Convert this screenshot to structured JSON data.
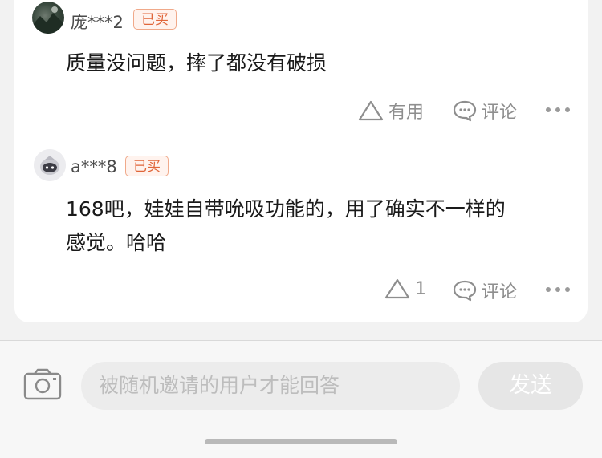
{
  "reviews": [
    {
      "username": "庞***2",
      "badge": "已买",
      "content": "质量没问题，摔了都没有破损",
      "like_label": "有用",
      "comment_label": "评论"
    },
    {
      "username": "a***8",
      "badge": "已买",
      "content_line1": "168吧，娃娃自带吮吸功能的，用了确实不一样的",
      "content_line2": "感觉。哈哈",
      "like_label": "1",
      "comment_label": "评论"
    }
  ],
  "composer": {
    "placeholder": "被随机邀请的用户才能回答",
    "send_label": "发送"
  },
  "colors": {
    "badge_text": "#e0663a",
    "badge_border": "#f0a98a",
    "icon_gray": "#8e8e8e"
  }
}
